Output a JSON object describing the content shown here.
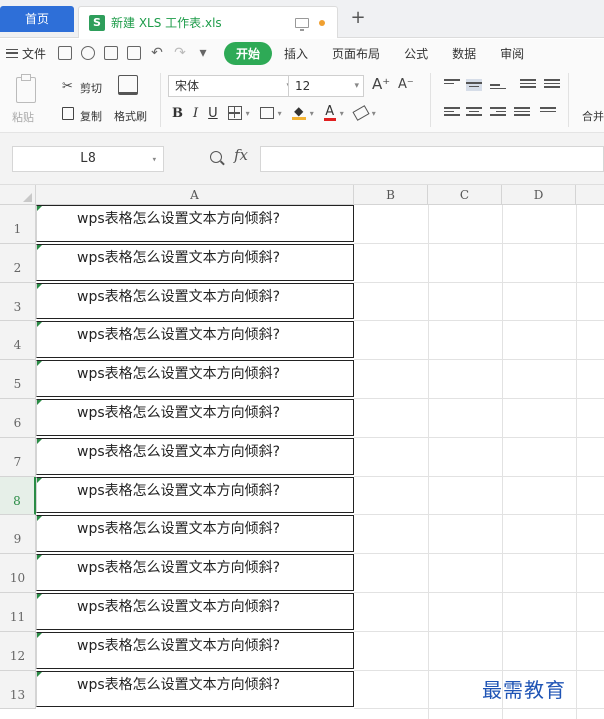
{
  "tabs": {
    "home_label": "首页",
    "file_badge": "S",
    "file_title": "新建 XLS 工作表.xls",
    "add_label": "+"
  },
  "menu": {
    "file_label": "文件",
    "tabs": [
      {
        "label": "开始",
        "active": true
      },
      {
        "label": "插入",
        "active": false
      },
      {
        "label": "页面布局",
        "active": false
      },
      {
        "label": "公式",
        "active": false
      },
      {
        "label": "数据",
        "active": false
      },
      {
        "label": "审阅",
        "active": false
      }
    ]
  },
  "ribbon": {
    "paste_label": "粘贴",
    "cut_label": "剪切",
    "copy_label": "复制",
    "format_painter_label": "格式刷",
    "font_name": "宋体",
    "font_size": "12",
    "grow_font": "A⁺",
    "shrink_font": "A⁻",
    "merge_label": "合并"
  },
  "formula_bar": {
    "name_box": "L8",
    "fx_label": "fx",
    "formula_value": ""
  },
  "grid": {
    "columns": [
      "A",
      "B",
      "C",
      "D"
    ],
    "active_row": 8,
    "rows": [
      {
        "number": "1",
        "a": "wps表格怎么设置文本方向倾斜?"
      },
      {
        "number": "2",
        "a": "wps表格怎么设置文本方向倾斜?"
      },
      {
        "number": "3",
        "a": "wps表格怎么设置文本方向倾斜?"
      },
      {
        "number": "4",
        "a": "wps表格怎么设置文本方向倾斜?"
      },
      {
        "number": "5",
        "a": "wps表格怎么设置文本方向倾斜?"
      },
      {
        "number": "6",
        "a": "wps表格怎么设置文本方向倾斜?"
      },
      {
        "number": "7",
        "a": "wps表格怎么设置文本方向倾斜?"
      },
      {
        "number": "8",
        "a": "wps表格怎么设置文本方向倾斜?"
      },
      {
        "number": "9",
        "a": "wps表格怎么设置文本方向倾斜?"
      },
      {
        "number": "10",
        "a": "wps表格怎么设置文本方向倾斜?"
      },
      {
        "number": "11",
        "a": "wps表格怎么设置文本方向倾斜?"
      },
      {
        "number": "12",
        "a": "wps表格怎么设置文本方向倾斜?"
      },
      {
        "number": "13",
        "a": "wps表格怎么设置文本方向倾斜?"
      }
    ]
  },
  "watermark": "最需教育",
  "colors": {
    "accent_green": "#2eaa56",
    "home_tab_blue": "#2e6fd8",
    "cell_marker": "#2a8c46"
  }
}
